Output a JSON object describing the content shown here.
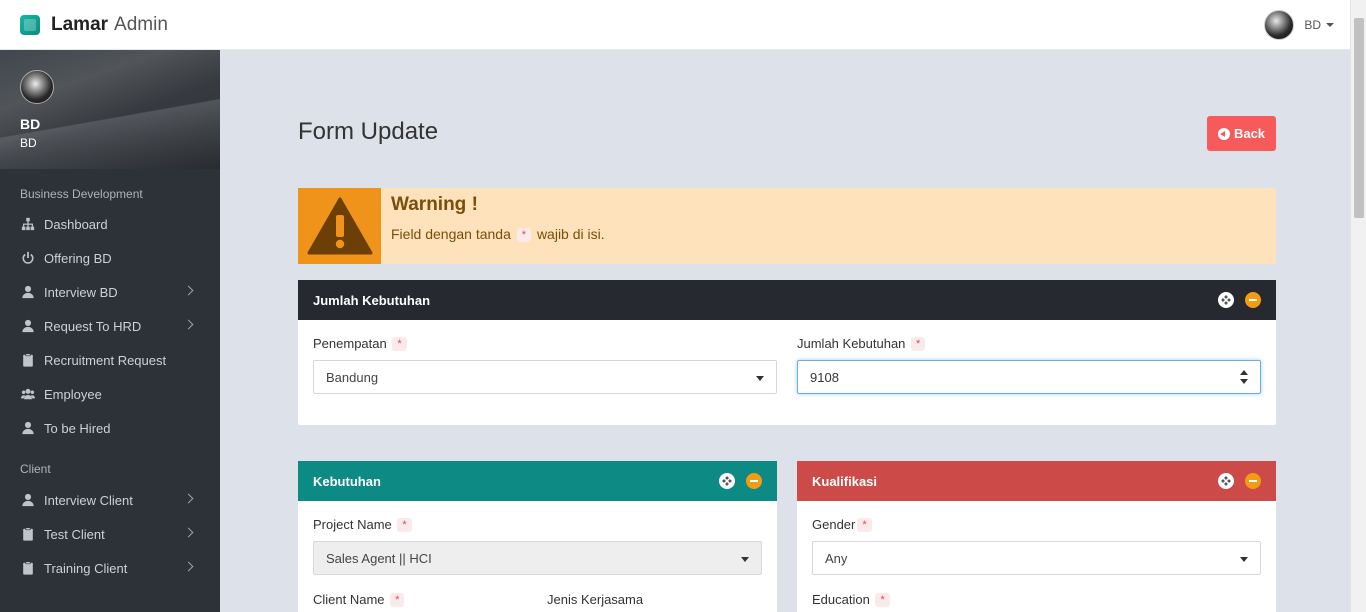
{
  "app": {
    "brand_bold": "Lamar",
    "brand_light": "Admin"
  },
  "topbar": {
    "user_label": "BD"
  },
  "sidebar": {
    "profile": {
      "name": "BD",
      "role": "BD"
    },
    "sections": [
      {
        "title": "Business Development",
        "items": [
          {
            "label": "Dashboard",
            "icon": "sitemap-icon",
            "has_submenu": false
          },
          {
            "label": "Offering BD",
            "icon": "power-icon",
            "has_submenu": false
          },
          {
            "label": "Interview BD",
            "icon": "user-icon",
            "has_submenu": true
          },
          {
            "label": "Request To HRD",
            "icon": "user-icon",
            "has_submenu": true
          },
          {
            "label": "Recruitment Request",
            "icon": "clipboard-icon",
            "has_submenu": false
          },
          {
            "label": "Employee",
            "icon": "users-icon",
            "has_submenu": false
          },
          {
            "label": "To be Hired",
            "icon": "user-icon",
            "has_submenu": false
          }
        ]
      },
      {
        "title": "Client",
        "items": [
          {
            "label": "Interview Client",
            "icon": "user-icon",
            "has_submenu": true
          },
          {
            "label": "Test Client",
            "icon": "clipboard-icon",
            "has_submenu": true
          },
          {
            "label": "Training Client",
            "icon": "clipboard-icon",
            "has_submenu": true
          }
        ]
      }
    ]
  },
  "page": {
    "title": "Form Update",
    "back_label": "Back"
  },
  "warning": {
    "title": "Warning !",
    "text_before": "Field dengan tanda",
    "required_mark": "*",
    "text_after": "wajib di isi."
  },
  "panel_jumlah": {
    "title": "Jumlah Kebutuhan",
    "header_color": "#262a30",
    "penempatan_label": "Penempatan",
    "penempatan_value": "Bandung",
    "jumlah_label": "Jumlah Kebutuhan",
    "jumlah_value": "9108"
  },
  "panel_kebutuhan": {
    "title": "Kebutuhan",
    "header_color": "#0d8a84",
    "project_label": "Project Name",
    "project_value": "Sales Agent || HCI",
    "client_label": "Client Name",
    "jenis_label": "Jenis Kerjasama"
  },
  "panel_kualifikasi": {
    "title": "Kualifikasi",
    "header_color": "#cc4b48",
    "gender_label": "Gender",
    "gender_value": "Any",
    "education_label": "Education"
  },
  "colors": {
    "accent": "#0d8a84",
    "danger": "#f75a5a",
    "warning": "#f0931a",
    "sidebar": "#2d3238"
  }
}
